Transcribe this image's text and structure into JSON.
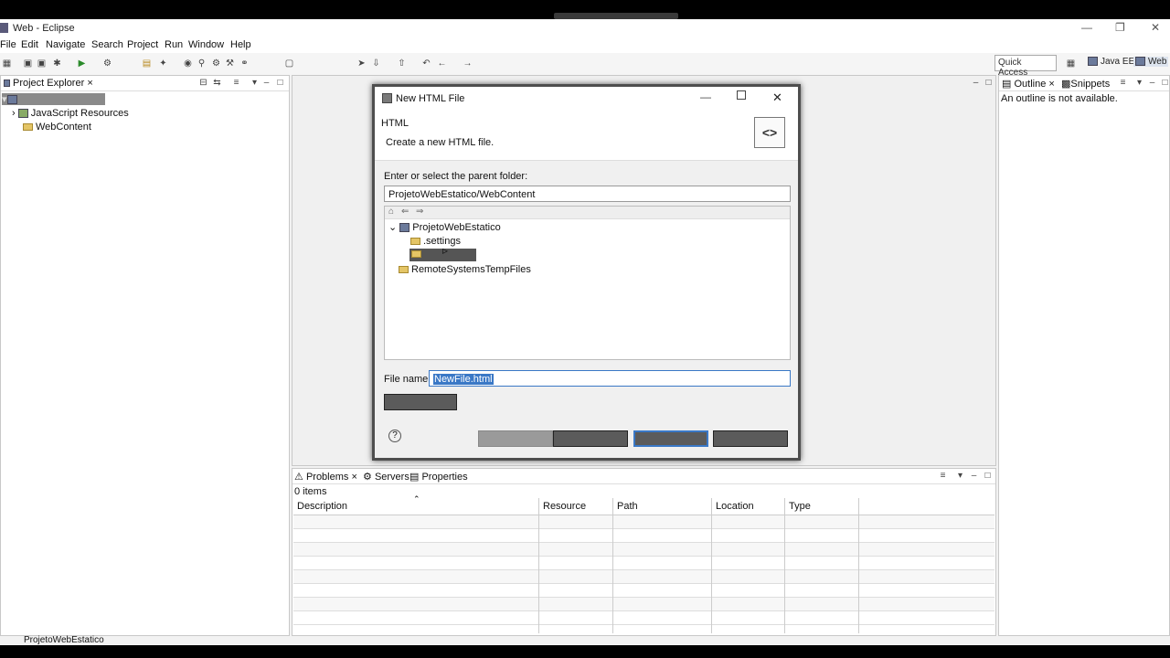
{
  "window": {
    "title": "Web - Eclipse"
  },
  "menu": [
    "File",
    "Edit",
    "Navigate",
    "Search",
    "Project",
    "Run",
    "Window",
    "Help"
  ],
  "toolbar": {
    "quick_access": "Quick Access",
    "perspectives": [
      "Java EE",
      "Web"
    ]
  },
  "project_explorer": {
    "tab": "Project Explorer",
    "items": [
      "JavaScript Resources",
      "WebContent"
    ]
  },
  "outline": {
    "tabs": [
      "Outline",
      "Snippets"
    ],
    "empty_text": "An outline is not available."
  },
  "dialog": {
    "title": "New HTML File",
    "heading": "HTML",
    "description": "Create a new HTML file.",
    "parent_label": "Enter or select the parent folder:",
    "parent_value": "ProjetoWebEstatico/WebContent",
    "tree": {
      "root": "ProjetoWebEstatico",
      "children": [
        ".settings"
      ],
      "sibling": "RemoteSystemsTempFiles"
    },
    "file_name_label": "File name:",
    "file_name_value": "NewFile.html"
  },
  "problems": {
    "tabs": [
      "Problems",
      "Servers",
      "Properties"
    ],
    "count": "0 items",
    "columns": [
      "Description",
      "Resource",
      "Path",
      "Location",
      "Type"
    ]
  },
  "status": {
    "text": "ProjetoWebEstatico"
  }
}
